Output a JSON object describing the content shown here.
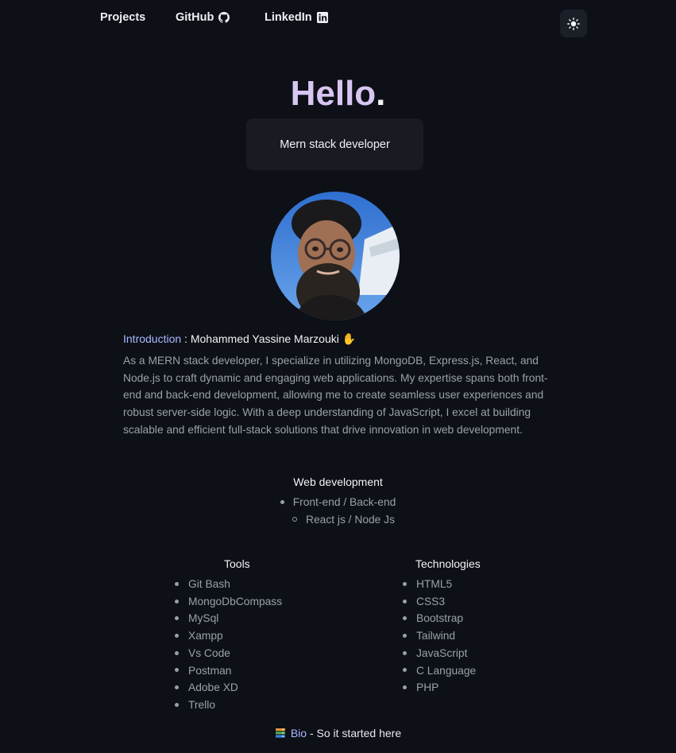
{
  "nav": {
    "projects": "Projects",
    "github": "GitHub",
    "linkedin": "LinkedIn"
  },
  "icons": {
    "github": "github-icon",
    "linkedin": "linkedin-icon",
    "theme": "sun-icon",
    "books": "books-icon"
  },
  "hero": {
    "title": "Hello",
    "title_dot": ".",
    "role": "Mern stack developer"
  },
  "intro": {
    "label": "Introduction",
    "separator": " : ",
    "name": "Mohammed Yassine Marzouki",
    "emoji": "✋",
    "text": "As a MERN stack developer, I specialize in utilizing MongoDB, Express.js, React, and Node.js to craft dynamic and engaging web applications. My expertise spans both front-end and back-end development, allowing me to create seamless user experiences and robust server-side logic. With a deep understanding of JavaScript, I excel at building scalable and efficient full-stack solutions that drive innovation in web development."
  },
  "web_development": {
    "title": "Web development",
    "items": [
      "Front-end / Back-end",
      "React js / Node Js"
    ]
  },
  "tools": {
    "title": "Tools",
    "items": [
      "Git Bash",
      "MongoDbCompass",
      "MySql",
      "Xampp",
      "Vs Code",
      "Postman",
      "Adobe XD",
      "Trello"
    ]
  },
  "technologies": {
    "title": "Technologies",
    "items": [
      "HTML5",
      "CSS3",
      "Bootstrap",
      "Tailwind",
      "JavaScript",
      "C Language",
      "PHP"
    ]
  },
  "bio": {
    "link": "Bio",
    "text": " - So it started here"
  },
  "colors": {
    "background": "#0d1017",
    "accent": "#a9b9ff",
    "title": "#d8c6f2",
    "muted": "#9aa0aa"
  }
}
